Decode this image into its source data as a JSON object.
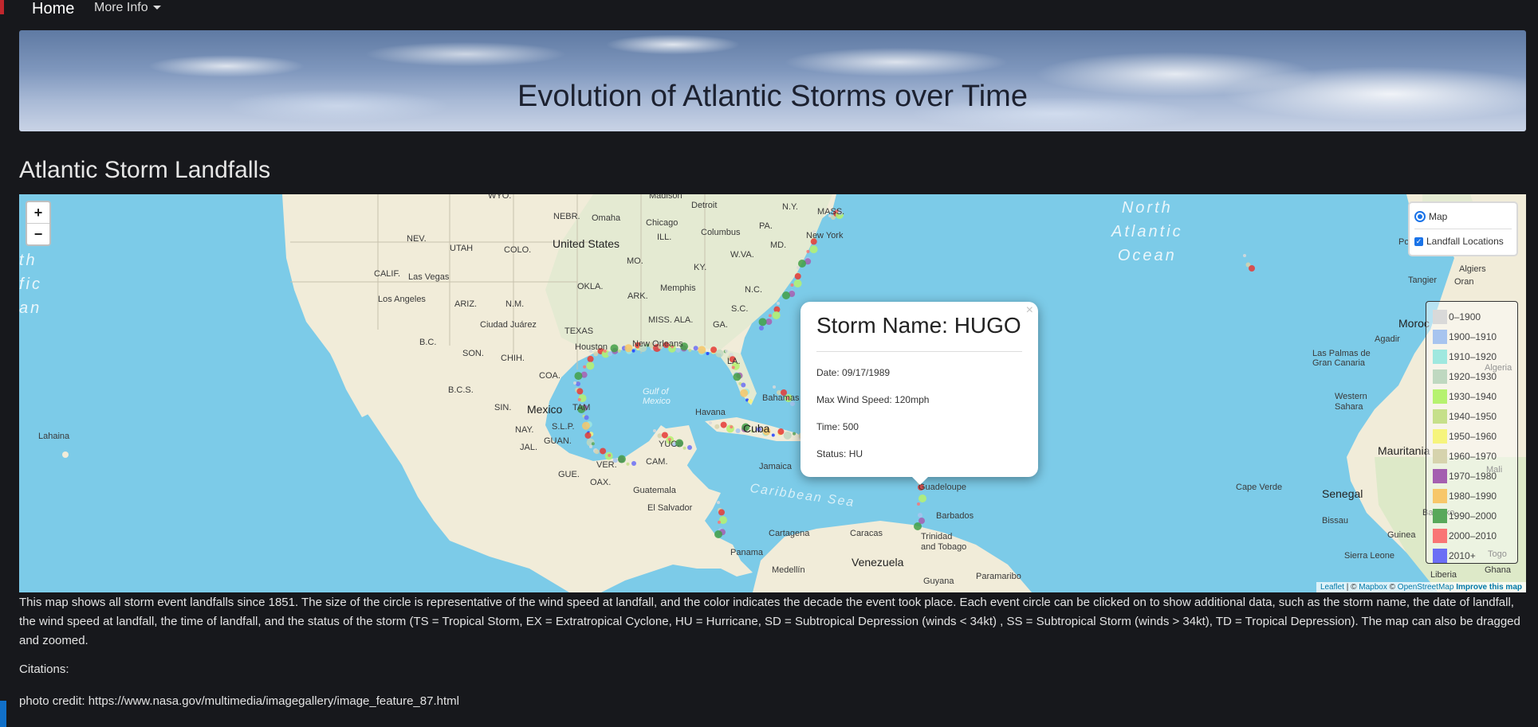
{
  "nav": {
    "home": "Home",
    "more_info": "More Info"
  },
  "banner": {
    "title": "Evolution of Atlantic Storms over Time"
  },
  "section_title": "Atlantic Storm Landfalls",
  "map": {
    "zoom_in": "+",
    "zoom_out": "−",
    "layers": {
      "base": "Map",
      "overlay": "Landfall Locations"
    },
    "labels": {
      "wyo": "WYO.",
      "nebr": "NEBR.",
      "omaha": "Omaha",
      "chicago": "Chicago",
      "madison": "Madison",
      "detroit": "Detroit",
      "ny": "N.Y.",
      "mass": "MASS.",
      "newyork": "New York",
      "nev": "NEV.",
      "utah": "UTAH",
      "colo": "COLO.",
      "unitedstates": "United States",
      "ill": "ILL.",
      "columbus": "Columbus",
      "pa": "PA.",
      "md": "MD.",
      "wva": "W.VA.",
      "mo": "MO.",
      "ky": "KY.",
      "calif": "CALIF.",
      "lasvegas": "Las Vegas",
      "losangeles": "Los Angeles",
      "okla": "OKLA.",
      "memphis": "Memphis",
      "nc": "N.C.",
      "ariz": "ARIZ.",
      "nm": "N.M.",
      "ark": "ARK.",
      "sc": "S.C.",
      "ciudadjuarez": "Ciudad Juárez",
      "missala": "MISS. ALA.",
      "ga": "GA.",
      "texas": "TEXAS",
      "bc": "B.C.",
      "son": "SON.",
      "chih": "CHIH.",
      "houston": "Houston",
      "neworleans": "New Orleans",
      "la": "LA.",
      "coa": "COA.",
      "bcs": "B.C.S.",
      "gulf": "Gulf of\nMexico",
      "sin": "SIN.",
      "mexico": "Mexico",
      "tam": "TAM",
      "havana": "Havana",
      "cuba": "Cuba",
      "bahamas": "Bahamas",
      "lahaina": "Lahaina",
      "nay": "NAY.",
      "slp": "S.L.P.",
      "jal": "JAL.",
      "guan": "GUAN.",
      "yuc": "YUC.",
      "cam": "CAM.",
      "ver": "VER.",
      "gue": "GUE.",
      "oax": "OAX.",
      "jamaica": "Jamaica",
      "guatemala": "Guatemala",
      "elsalvador": "El Salvador",
      "caribbean": "Caribbean Sea",
      "guadeloupe": "Guadeloupe",
      "barbados": "Barbados",
      "trinidad": "Trinidad\nand Tobago",
      "cartagena": "Cartagena",
      "caracas": "Caracas",
      "panama": "Panama",
      "venezuela": "Venezuela",
      "medellin": "Medellín",
      "guyana": "Guyana",
      "paramaribo": "Paramaribo",
      "northatlantic": "North\nAtlantic\nOcean",
      "ocean_left": "th\nfic\nan",
      "portugal": "Portugal",
      "algiers": "Algiers",
      "tangier": "Tangier",
      "oran": "Oran",
      "morocco": "Moroc",
      "agadir": "Agadir",
      "laspalmas": "Las Palmas de\nGran Canaria",
      "algeria": "Algeria",
      "westernsahara": "Western\nSahara",
      "mauritania": "Mauritania",
      "mali": "Mali",
      "capeverde": "Cape Verde",
      "senegal": "Senegal",
      "bamako": "Bamako",
      "bissau": "Bissau",
      "guinea": "Guinea",
      "sierraleone": "Sierra Leone",
      "liberia": "Liberia",
      "togo": "Togo",
      "ghana": "Ghana"
    },
    "legend": [
      {
        "label": "0–1900",
        "color": "#d9d9d9"
      },
      {
        "label": "1900–1910",
        "color": "#a7c4ef"
      },
      {
        "label": "1910–1920",
        "color": "#9fe8df"
      },
      {
        "label": "1920–1930",
        "color": "#bfd8c0"
      },
      {
        "label": "1930–1940",
        "color": "#b6f26f"
      },
      {
        "label": "1940–1950",
        "color": "#c6e08a"
      },
      {
        "label": "1950–1960",
        "color": "#f6f47c"
      },
      {
        "label": "1960–1970",
        "color": "#d6d3ad"
      },
      {
        "label": "1970–1980",
        "color": "#a45fb0"
      },
      {
        "label": "1980–1990",
        "color": "#f7c769"
      },
      {
        "label": "1990–2000",
        "color": "#58a85a"
      },
      {
        "label": "2000–2010",
        "color": "#f97575"
      },
      {
        "label": "2010+",
        "color": "#6b6ef5"
      }
    ],
    "popup": {
      "close": "×",
      "title": "Storm Name: HUGO",
      "date": "Date: 09/17/1989",
      "wind": "Max Wind Speed: 120mph",
      "time": "Time: 500",
      "status": "Status: HU"
    },
    "attribution": {
      "leaflet": "Leaflet",
      "sep1": " | © ",
      "mapbox": "Mapbox",
      "sep2": " © ",
      "osm": "OpenStreetMap",
      "improve": "Improve this map"
    }
  },
  "description": "This map shows all storm event landfalls since 1851. The size of the circle is representative of the wind speed at landfall, and the color indicates the decade the event took place. Each event circle can be clicked on to show additional data, such as the storm name, the date of landfall, the wind speed at landfall, the time of landfall, and the status of the storm (TS = Tropical Storm, EX = Extratropical Cyclone, HU = Hurricane, SD = Subtropical Depression (winds < 34kt) , SS = Subtropical Storm (winds > 34kt), TD = Tropical Depression). The map can also be dragged and zoomed.",
  "citations": "Citations:",
  "photo_credit": "photo credit: https://www.nasa.gov/multimedia/imagegallery/image_feature_87.html"
}
